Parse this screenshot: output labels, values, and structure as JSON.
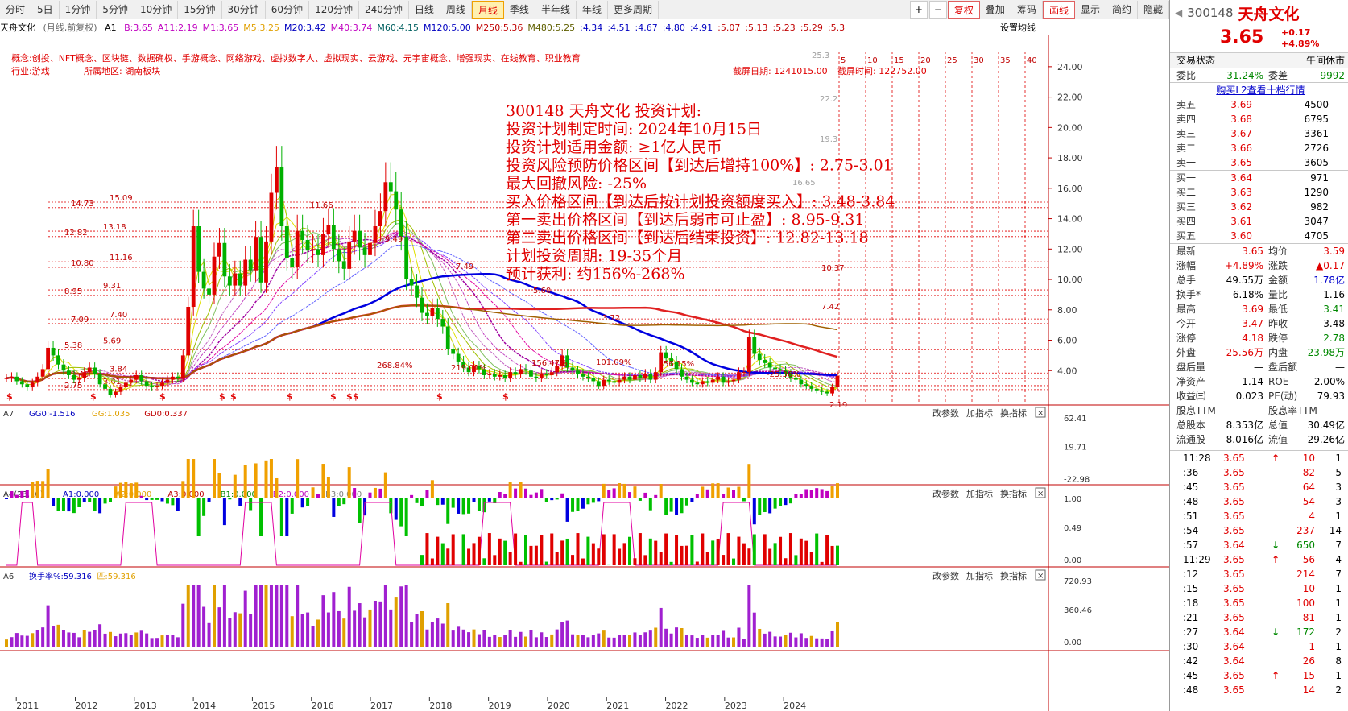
{
  "toolbar": {
    "periods": [
      "分时",
      "5日",
      "1分钟",
      "5分钟",
      "10分钟",
      "15分钟",
      "30分钟",
      "60分钟",
      "120分钟",
      "240分钟",
      "日线",
      "周线",
      "月线",
      "季线",
      "半年线",
      "年线",
      "更多周期"
    ],
    "active_period": "月线",
    "right_buttons": [
      "复权",
      "叠加",
      "筹码",
      "画线",
      "显示",
      "简约",
      "隐藏"
    ]
  },
  "infoline": {
    "stock": "天舟文化",
    "mode": "(月线,前复权)",
    "indicator": "A1",
    "ma": [
      "B:3.65",
      "A11:2.19",
      "M1:3.65",
      "M5:3.25",
      "M20:3.42",
      "M40:3.74",
      "M60:4.15",
      "M120:5.00",
      "M250:5.36",
      "M480:5.25"
    ],
    "ma2": [
      ":4.34",
      ":4.51",
      ":4.67",
      ":4.80",
      ":4.91",
      ":5.07",
      ":5.13",
      ":5.23",
      ":5.29",
      ":5.3"
    ],
    "setting": "设置均线"
  },
  "concept": {
    "line1": "概念:创投、NFT概念、区块链、数据确权、手游概念、网络游戏、虚拟数字人、虚拟现实、云游戏、元宇宙概念、增强现实、在线教育、职业教育",
    "industry": "行业:游戏",
    "region": "所属地区: 湖南板块",
    "screenshot_date": "截屏日期: 1241015.00",
    "screenshot_time": "截屏时间: 122752.00"
  },
  "plan": {
    "lines": [
      "300148 天舟文化 投资计划:",
      "投资计划制定时间: 2024年10月15日",
      "投资计划适用金额: ≥1亿人民币",
      "投资风险预防价格区间【到达后增持100%】: 2.75-3.01",
      "最大回撤风险: -25%",
      "买入价格区间【到达后按计划投资额度买入】: 3.48-3.84",
      "第一卖出价格区间【到达后弱市可止盈】: 8.95-9.31",
      "第二卖出价格区间【到达后结束投资】: 12.82-13.18",
      "计划投资周期: 19-35个月",
      "预计获利: 约156%-268%"
    ]
  },
  "chart_data": [
    {
      "type": "candlestick",
      "title": "天舟文化 月线 前复权",
      "ylim": [
        2,
        25
      ],
      "yticks": [
        "24.00",
        "22.00",
        "20.00",
        "18.00",
        "16.00",
        "14.00",
        "12.00",
        "10.00",
        "8.00",
        "6.00",
        "4.00"
      ],
      "xticks": [
        "2011",
        "2012",
        "2013",
        "2014",
        "2015",
        "2016",
        "2017",
        "2018",
        "2019",
        "2020",
        "2021",
        "2022",
        "2023",
        "2024"
      ],
      "price_lines": [
        {
          "label": "14.73",
          "value": 14.73
        },
        {
          "label": "15.09",
          "value": 15.09
        },
        {
          "label": "12.82",
          "value": 12.82
        },
        {
          "label": "13.18",
          "value": 13.18
        },
        {
          "label": "10.80",
          "value": 10.8
        },
        {
          "label": "11.16",
          "value": 11.16
        },
        {
          "label": "8.95",
          "value": 8.95
        },
        {
          "label": "9.31",
          "value": 9.31
        },
        {
          "label": "7.09",
          "value": 7.09
        },
        {
          "label": "7.40",
          "value": 7.4
        },
        {
          "label": "5.38",
          "value": 5.38
        },
        {
          "label": "5.69",
          "value": 5.69
        },
        {
          "label": "3.48",
          "value": 3.48
        },
        {
          "label": "3.84",
          "value": 3.84
        },
        {
          "label": "2.75",
          "value": 2.75
        },
        {
          "label": "3.01",
          "value": 3.01
        }
      ],
      "annotations": [
        "25.3",
        "22.2",
        "19.3",
        "16.65",
        "11.66",
        "9.49",
        "7.49",
        "5.60",
        "3.72",
        "2.19",
        "268.84%",
        "219.01%",
        "156.47%",
        "101.09%",
        "56.15%",
        "-25.36%",
        "10.37",
        "7.42"
      ],
      "fib_counts": [
        "5",
        "10",
        "15",
        "20",
        "25",
        "30",
        "35",
        "40"
      ],
      "close_series": [
        3.5,
        3.6,
        3.3,
        3.1,
        2.9,
        3.2,
        3.6,
        4.1,
        5.5,
        5.0,
        4.4,
        4.0,
        3.7,
        3.4,
        3.5,
        3.9,
        4.2,
        3.8,
        3.1,
        2.8,
        2.4,
        2.6,
        2.9,
        3.2,
        3.4,
        3.7,
        3.3,
        3.0,
        2.9,
        3.0,
        3.2,
        3.4,
        3.6,
        3.5,
        5.0,
        8.2,
        13.5,
        10.5,
        9.4,
        9.0,
        11.5,
        12.4,
        10.2,
        9.6,
        10.4,
        9.6,
        11.3,
        10.6,
        12.8,
        9.8,
        12.5,
        15.7,
        17.4,
        13.5,
        11.4,
        10.8,
        13.2,
        12.6,
        11.9,
        12.0,
        11.6,
        13.0,
        13.6,
        12.0,
        11.2,
        10.7,
        12.5,
        13.2,
        12.1,
        11.6,
        12.4,
        13.5,
        14.5,
        16.4,
        15.8,
        14.6,
        12.8,
        10.0,
        9.6,
        8.8,
        7.8,
        7.6,
        8.1,
        7.4,
        6.9,
        5.4,
        5.1,
        4.6,
        4.2,
        3.9,
        4.3,
        4.1,
        3.7,
        3.8,
        3.6,
        3.7,
        3.5,
        3.9,
        3.8,
        4.1,
        4.0,
        3.6,
        3.5,
        3.8,
        3.7,
        3.9,
        4.3,
        5.0,
        4.2,
        4.0,
        3.8,
        3.6,
        3.5,
        3.3,
        3.0,
        3.4,
        3.3,
        3.2,
        3.4,
        3.6,
        3.4,
        3.7,
        3.5,
        3.8,
        3.4,
        3.9,
        5.2,
        4.8,
        4.6,
        4.1,
        3.6,
        3.4,
        3.2,
        3.1,
        3.3,
        3.2,
        3.4,
        3.6,
        3.2,
        3.3,
        3.4,
        3.9,
        3.9,
        6.2,
        5.1,
        4.7,
        4.5,
        4.2,
        4.1,
        4.0,
        3.8,
        3.5,
        3.4,
        3.1,
        3.0,
        2.8,
        2.7,
        2.6,
        2.5,
        2.9,
        3.65
      ]
    },
    {
      "type": "bar",
      "title": "A7",
      "series_labels": [
        "GG0:-1.516",
        "GG:1.035",
        "GD0:0.337"
      ],
      "yticks": [
        "62.41",
        "19.71",
        "-22.98"
      ]
    },
    {
      "type": "line",
      "title": "A4(23,10)",
      "series_labels": [
        "A1:0.000",
        "A2:0.000",
        "A3:0.000",
        "B1:0.000",
        "B2:0.000",
        "B3:0.000"
      ],
      "yticks": [
        "1.00",
        "0.49",
        "0.00"
      ]
    },
    {
      "type": "bar",
      "title": "A6",
      "series_labels": [
        "换手率%:59.316",
        "匹:59.316"
      ],
      "yticks": [
        "720.93",
        "360.46",
        "0.00"
      ]
    }
  ],
  "subpanel_buttons": [
    "改参数",
    "加指标",
    "换指标"
  ],
  "panel": {
    "code": "300148",
    "name": "天舟文化",
    "price": "3.65",
    "change": "+0.17",
    "change_pct": "+4.89%",
    "status_label": "交易状态",
    "status": "午间休市",
    "webi_label": "委比",
    "webi": "-31.24%",
    "weicha_label": "委差",
    "weicha": "-9992",
    "l2_link": "购买L2查看十档行情",
    "asks": [
      [
        "卖五",
        "3.69",
        "4500"
      ],
      [
        "卖四",
        "3.68",
        "6795"
      ],
      [
        "卖三",
        "3.67",
        "3361"
      ],
      [
        "卖二",
        "3.66",
        "2726"
      ],
      [
        "卖一",
        "3.65",
        "3605"
      ]
    ],
    "bids": [
      [
        "买一",
        "3.64",
        "971"
      ],
      [
        "买二",
        "3.63",
        "1290"
      ],
      [
        "买三",
        "3.62",
        "982"
      ],
      [
        "买四",
        "3.61",
        "3047"
      ],
      [
        "买五",
        "3.60",
        "4705"
      ]
    ],
    "stats": [
      [
        "最新",
        "3.65",
        "均价",
        "3.59"
      ],
      [
        "涨幅",
        "+4.89%",
        "涨跌",
        "▲0.17"
      ],
      [
        "总手",
        "49.55万",
        "金额",
        "1.78亿"
      ],
      [
        "换手*",
        "6.18%",
        "量比",
        "1.16"
      ],
      [
        "最高",
        "3.69",
        "最低",
        "3.41"
      ],
      [
        "今开",
        "3.47",
        "昨收",
        "3.48"
      ],
      [
        "涨停",
        "4.18",
        "跌停",
        "2.78"
      ],
      [
        "外盘",
        "25.56万",
        "内盘",
        "23.98万"
      ],
      [
        "盘后量",
        "—",
        "盘后额",
        "—"
      ],
      [
        "净资产",
        "1.14",
        "ROE",
        "2.00%"
      ],
      [
        "收益㈢",
        "0.023",
        "PE(动)",
        "79.93"
      ],
      [
        "股息TTM",
        "—",
        "股息率TTM",
        "—"
      ],
      [
        "总股本",
        "8.353亿",
        "总值",
        "30.49亿"
      ],
      [
        "流通股",
        "8.016亿",
        "流值",
        "29.26亿"
      ]
    ],
    "ticks": [
      [
        "11:28",
        "3.65",
        "↑",
        "10",
        "1"
      ],
      [
        ":36",
        "3.65",
        "",
        "82",
        "5"
      ],
      [
        ":45",
        "3.65",
        "",
        "64",
        "3"
      ],
      [
        ":48",
        "3.65",
        "",
        "54",
        "3"
      ],
      [
        ":51",
        "3.65",
        "",
        "4",
        "1"
      ],
      [
        ":54",
        "3.65",
        "",
        "237",
        "14"
      ],
      [
        ":57",
        "3.64",
        "↓",
        "650",
        "7"
      ],
      [
        "11:29",
        "3.65",
        "↑",
        "56",
        "4"
      ],
      [
        ":12",
        "3.65",
        "",
        "214",
        "7"
      ],
      [
        ":15",
        "3.65",
        "",
        "10",
        "1"
      ],
      [
        ":18",
        "3.65",
        "",
        "100",
        "1"
      ],
      [
        ":21",
        "3.65",
        "",
        "81",
        "1"
      ],
      [
        ":27",
        "3.64",
        "↓",
        "172",
        "2"
      ],
      [
        ":30",
        "3.64",
        "",
        "1",
        "1"
      ],
      [
        ":42",
        "3.64",
        "",
        "26",
        "8"
      ],
      [
        ":45",
        "3.65",
        "↑",
        "15",
        "1"
      ],
      [
        ":48",
        "3.65",
        "",
        "14",
        "2"
      ]
    ]
  }
}
